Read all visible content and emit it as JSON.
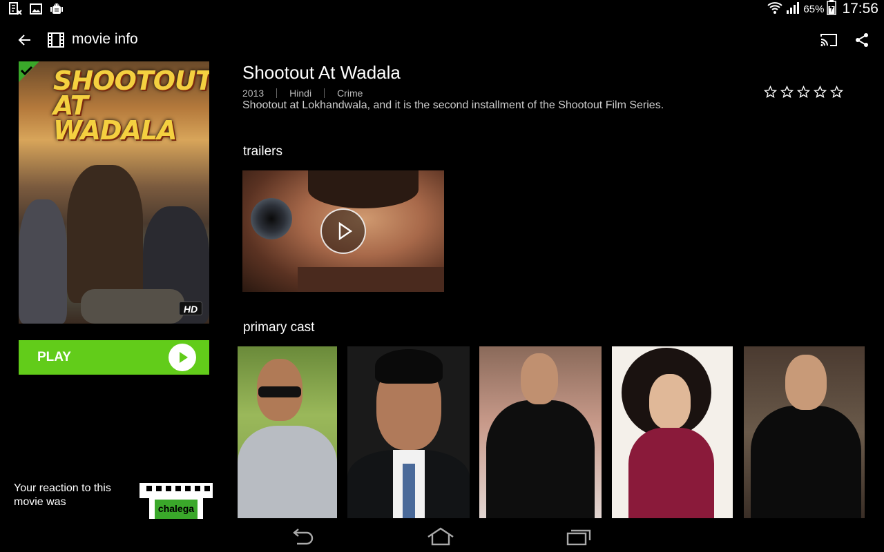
{
  "status_bar": {
    "left_icons": [
      "sim-error-icon",
      "image-icon",
      "android-debug-icon"
    ],
    "right_icons": [
      "wifi-icon",
      "cellular-signal-icon",
      "battery-charging-icon"
    ],
    "battery": "65%",
    "time": "17:56"
  },
  "action_bar": {
    "title": "movie info",
    "icons": [
      "back-arrow-icon",
      "film-icon",
      "cast-icon",
      "share-icon"
    ]
  },
  "poster": {
    "title_text": "SHOOTOUT AT WADALA",
    "badge": "HD",
    "watched_icon": "checkmark-icon"
  },
  "play_button": {
    "label": "PLAY",
    "color": "#62cc1a"
  },
  "reaction": {
    "text": "Your reaction to this movie was",
    "icon_label": "chalega"
  },
  "movie": {
    "title": "Shootout At Wadala",
    "year": "2013",
    "language": "Hindi",
    "genre": "Crime",
    "description": "Shootout at Lokhandwala, and it is the second installment of the Shootout Film Series.",
    "rating": 0,
    "rating_max": 5
  },
  "sections": {
    "trailers": "trailers",
    "primary_cast": "primary cast"
  },
  "trailers": [
    {
      "play_icon": "play-circle-icon"
    }
  ],
  "primary_cast_count": 5,
  "nav_bar": {
    "icons": [
      "nav-back-icon",
      "nav-home-icon",
      "nav-recents-icon"
    ]
  }
}
